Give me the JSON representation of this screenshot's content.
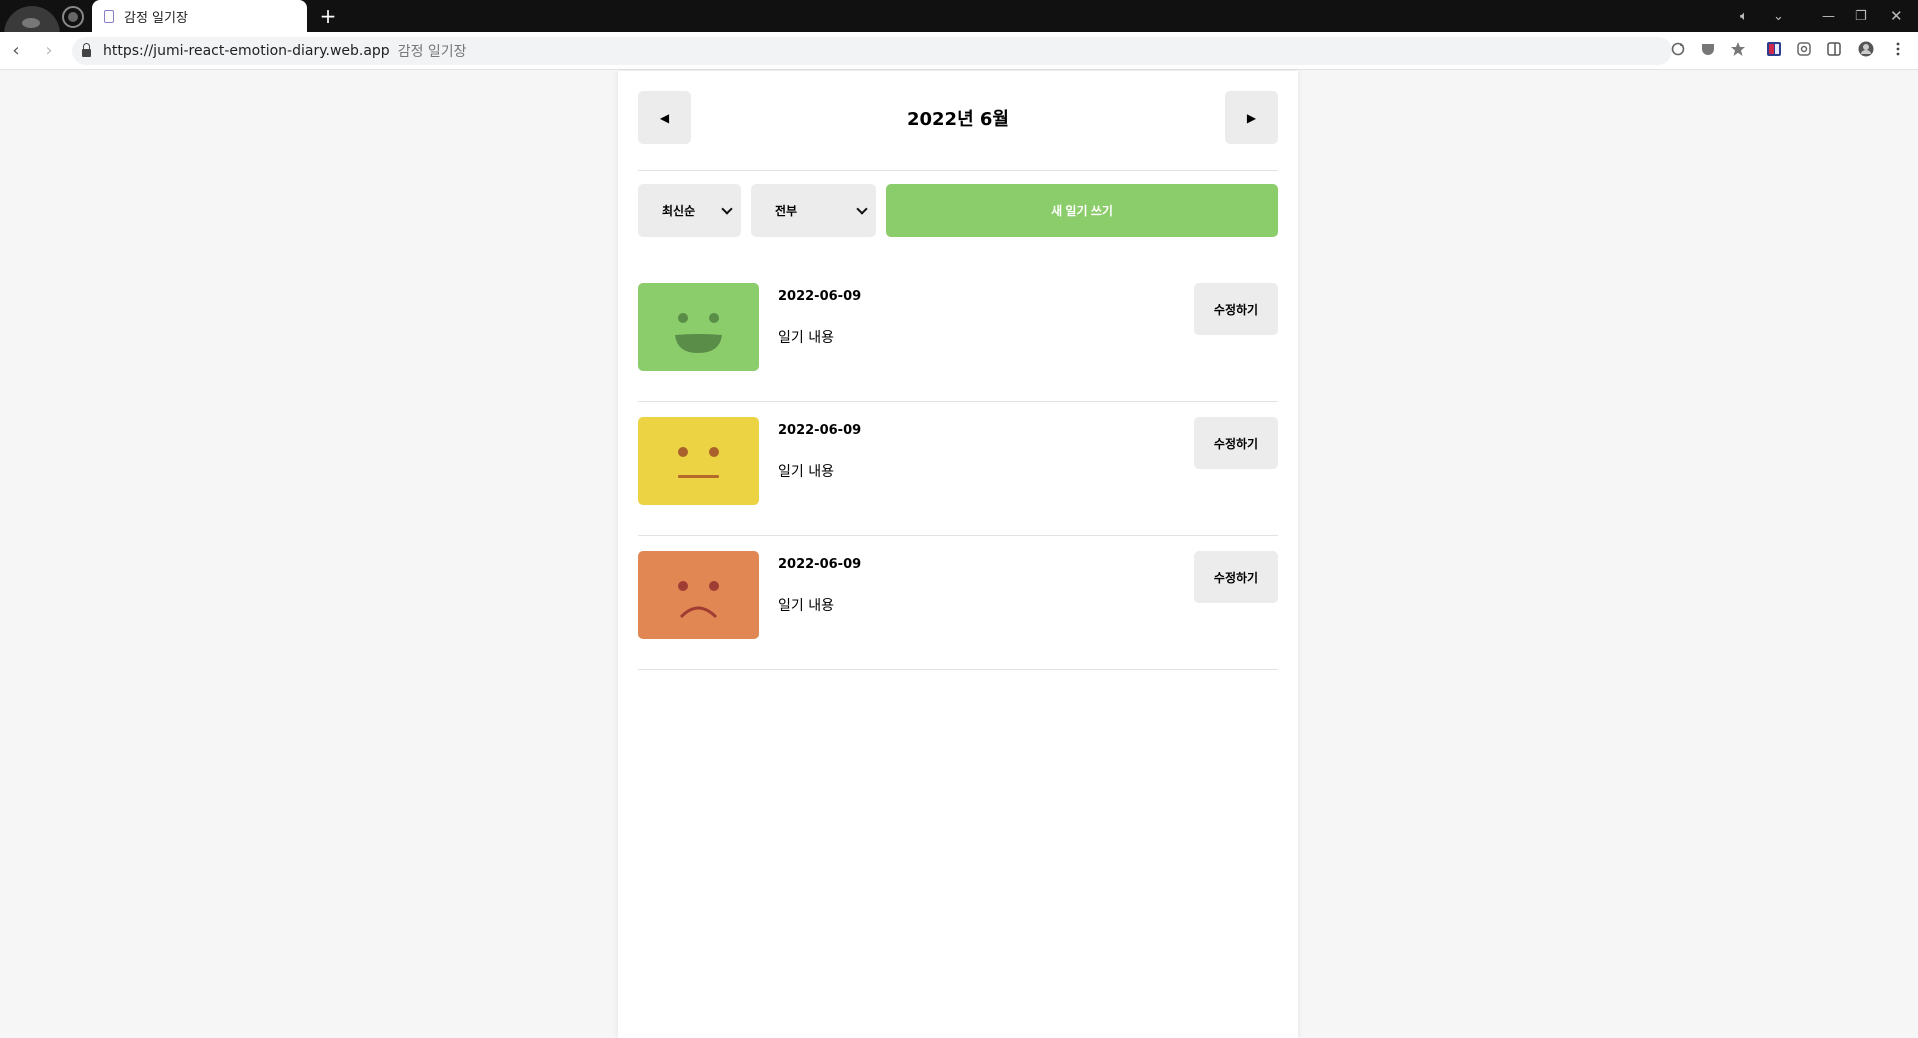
{
  "browser": {
    "tab_title": "감정 일기장",
    "new_tab": "+",
    "url": "https://jumi-react-emotion-diary.web.app",
    "url_title": "감정 일기장"
  },
  "header": {
    "prev_label": "◀",
    "title": "2022년 6월",
    "next_label": "▶"
  },
  "menu": {
    "order_selected": "최신순",
    "filter_selected": "전부",
    "new_button": "새 일기 쓰기"
  },
  "colors": {
    "accent_green": "#8bcc6b",
    "emotion_good": "#8bcc6b",
    "emotion_soso": "#ecd343",
    "emotion_bad": "#e08753"
  },
  "diary": [
    {
      "date": "2022-06-09",
      "content": "일기 내용",
      "emotion": "good",
      "emotion_icon": "smile-face-icon",
      "edit_label": "수정하기"
    },
    {
      "date": "2022-06-09",
      "content": "일기 내용",
      "emotion": "soso",
      "emotion_icon": "neutral-face-icon",
      "edit_label": "수정하기"
    },
    {
      "date": "2022-06-09",
      "content": "일기 내용",
      "emotion": "bad",
      "emotion_icon": "sad-face-icon",
      "edit_label": "수정하기"
    }
  ]
}
